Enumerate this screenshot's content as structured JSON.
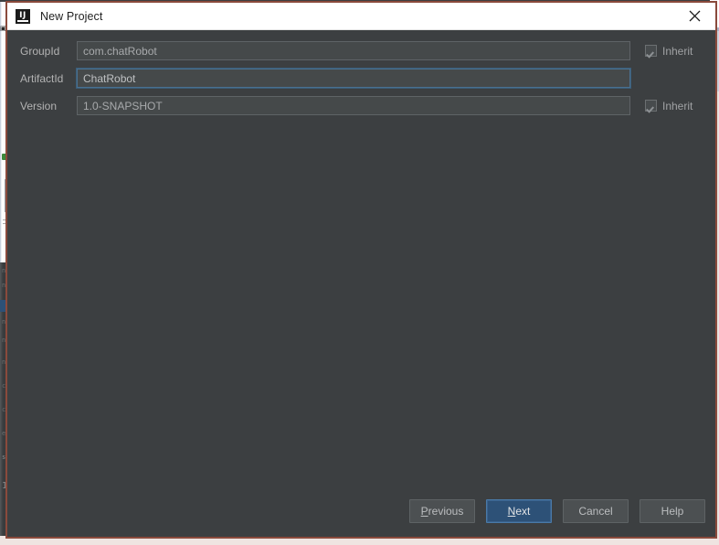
{
  "window": {
    "title": "New Project",
    "app_icon": "intellij-idea-icon",
    "close_icon": "close-icon",
    "border_color": "#8a4a3c",
    "titlebar_bg": "#ffffff",
    "body_bg": "#3c3f41"
  },
  "form": {
    "fields": [
      {
        "label": "GroupId",
        "value": "com.chatRobot",
        "focused": false,
        "inherit": {
          "label": "Inherit",
          "checked": true,
          "enabled": false
        }
      },
      {
        "label": "ArtifactId",
        "value": "ChatRobot",
        "focused": true,
        "inherit": null
      },
      {
        "label": "Version",
        "value": "1.0-SNAPSHOT",
        "focused": false,
        "inherit": {
          "label": "Inherit",
          "checked": true,
          "enabled": false
        }
      }
    ]
  },
  "footer": {
    "buttons": [
      {
        "label": "Previous",
        "mnemonic": "P",
        "primary": false
      },
      {
        "label": "Next",
        "mnemonic": "N",
        "primary": true
      },
      {
        "label": "Cancel",
        "mnemonic": "",
        "primary": false
      },
      {
        "label": "Help",
        "mnemonic": "",
        "primary": false
      }
    ]
  },
  "background": {
    "gutter_lines": [
      "n",
      "n",
      "n",
      "n",
      "n",
      "n",
      "c",
      "c",
      "e",
      "s",
      "1"
    ],
    "accent_selection": "#2d5177"
  }
}
